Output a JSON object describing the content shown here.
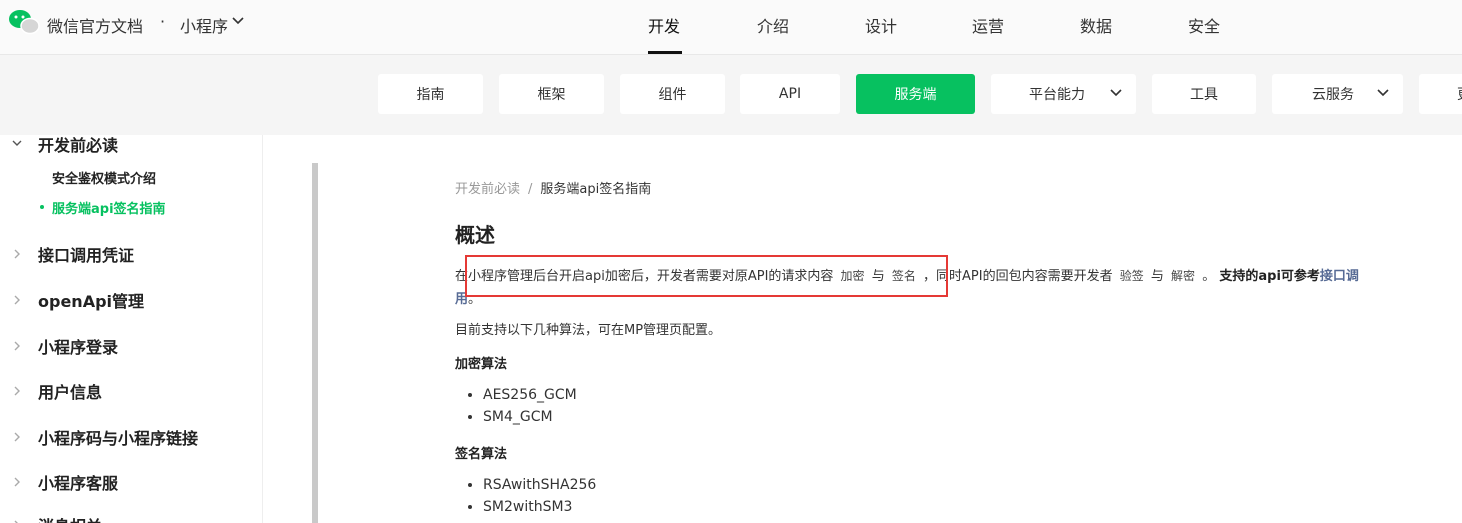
{
  "header": {
    "brand": "微信官方文档",
    "dot": "·",
    "product": "小程序",
    "nav": [
      "开发",
      "介绍",
      "设计",
      "运营",
      "数据",
      "安全"
    ],
    "active_nav": "开发"
  },
  "subnav": {
    "items": [
      "指南",
      "框架",
      "组件",
      "API",
      "服务端",
      "平台能力",
      "工具",
      "云服务",
      "更"
    ],
    "active": "服务端"
  },
  "sidebar": {
    "section": "开发前必读",
    "sub_items": [
      "安全鉴权模式介绍",
      "服务端api签名指南"
    ],
    "active_sub": "服务端api签名指南",
    "items": [
      "接口调用凭证",
      "openApi管理",
      "小程序登录",
      "用户信息",
      "小程序码与小程序链接",
      "小程序客服",
      "消息相关"
    ]
  },
  "content": {
    "breadcrumb": [
      "开发前必读",
      "服务端api签名指南"
    ],
    "breadcrumb_sep": "/",
    "title": "概述",
    "para1_a": "在小程序管理后台开启api加密后，开发者需要对原API的请求内容",
    "para1_code1": "加密",
    "para1_b": "与",
    "para1_code2": "签名",
    "para1_c": "，同时API的回包内容需要开发者",
    "para1_code3": "验签",
    "para1_d": "与",
    "para1_code4": "解密",
    "para1_e": "。",
    "para1_bold": "支持的api可参考",
    "para1_link1": "接口调",
    "para1_link2": "用",
    "para1_end": "。",
    "para2": "目前支持以下几种算法，可在MP管理页配置。",
    "enc_title": "加密算法",
    "enc_algos": [
      "AES256_GCM",
      "SM4_GCM"
    ],
    "sig_title": "签名算法",
    "sig_algos": [
      "RSAwithSHA256",
      "SM2withSM3"
    ]
  },
  "colors": {
    "accent": "#07c160",
    "highlight_box": "#e53935",
    "link": "#576b95"
  }
}
